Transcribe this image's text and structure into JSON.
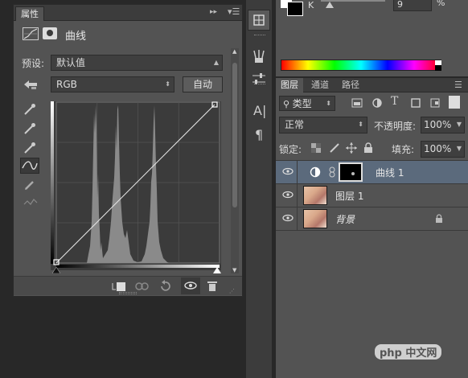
{
  "properties": {
    "tab_label": "属性",
    "header_title": "曲线",
    "preset_label": "预设:",
    "preset_value": "默认值",
    "channel_value": "RGB",
    "auto_label": "自动"
  },
  "color": {
    "k_label": "K",
    "k_value": "9",
    "percent": "%"
  },
  "layers": {
    "tabs": [
      "图层",
      "通道",
      "路径"
    ],
    "filter_kind": "类型",
    "blend_mode": "正常",
    "opacity_label": "不透明度:",
    "opacity_value": "100%",
    "lock_label": "锁定:",
    "fill_label": "填充:",
    "fill_value": "100%",
    "rows": [
      {
        "name": "曲线 1"
      },
      {
        "name": "图层 1"
      },
      {
        "name": "背景"
      }
    ]
  },
  "watermark": {
    "text": "php 中文网"
  }
}
